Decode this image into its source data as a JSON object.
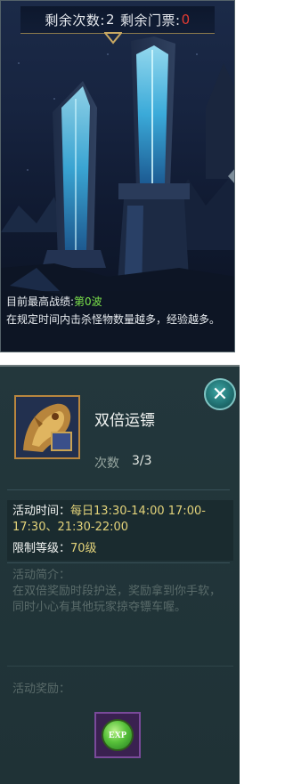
{
  "header": {
    "remaining_label": "剩余次数:",
    "remaining_value": "2",
    "tickets_label": "剩余门票:",
    "tickets_value": "0"
  },
  "info": {
    "best_label": "目前最高战绩:",
    "best_value": "第0波",
    "description": "在规定时间内击杀怪物数量越多，经验越多。"
  },
  "activity": {
    "title": "双倍运镖",
    "count_label": "次数",
    "count_value": "3/3",
    "time_label": "活动时间：",
    "time_value": "每日13:30-14:00 17:00-17:30、21:30-22:00",
    "level_label": "限制等级：",
    "level_value": "70级",
    "intro_label": "活动简介：",
    "intro_text": "在双倍奖励时段护送，奖励拿到你手软，同时小心有其他玩家掠夺镖车喔。",
    "reward_label": "活动奖励：",
    "reward_item": "EXP"
  },
  "colors": {
    "accent_red": "#e23b32",
    "accent_green": "#7be14a",
    "accent_yellow": "#e3d37a",
    "close_teal": "#2f8d8c"
  },
  "icons": {
    "close": "close-icon",
    "reward": "exp-icon",
    "side_arrow": "arrow-left-icon"
  }
}
